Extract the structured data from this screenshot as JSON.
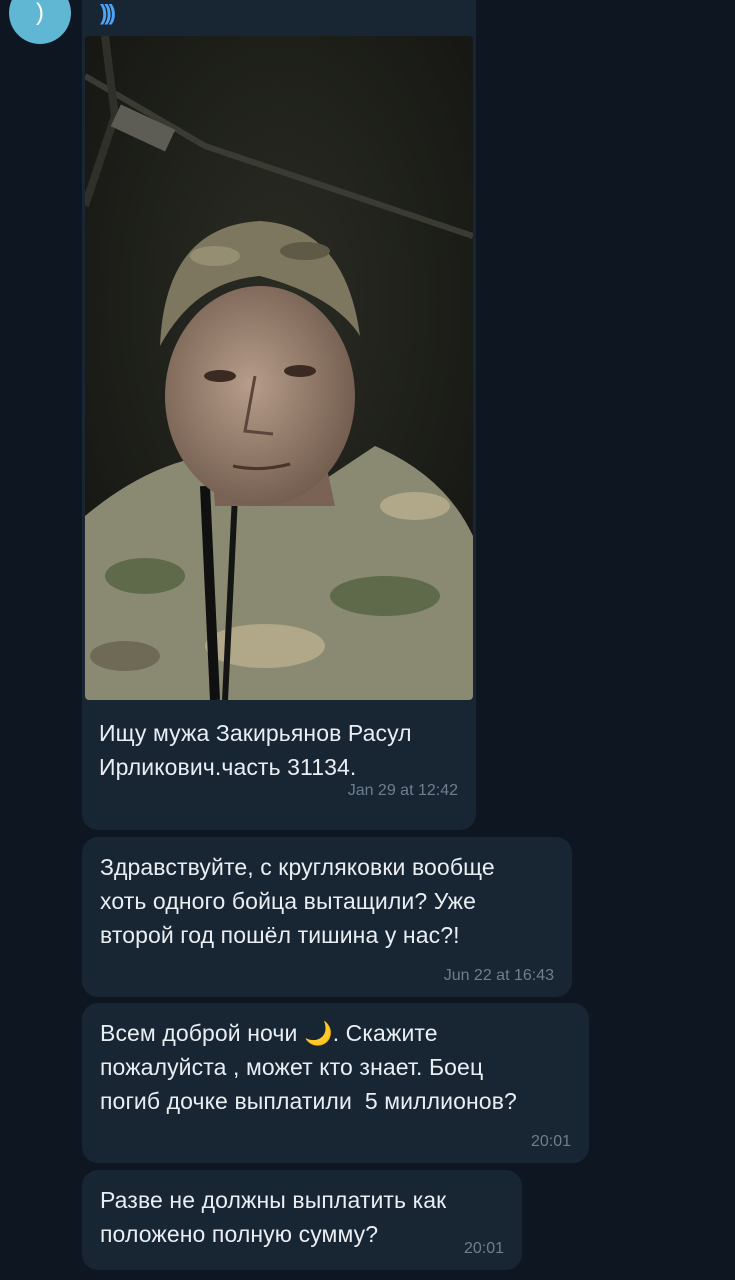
{
  "avatar": {
    "glyph": ")"
  },
  "messages": [
    {
      "caption": "Ищу мужа Закирьянов Расул\nИрликович.часть 31134.",
      "time": "Jan 29 at 12:42"
    },
    {
      "text": "Здравствуйте, с кругляковки вообще\nхоть одного бойца вытащили? Уже\nвторой год пошёл тишина у нас?!",
      "time": "Jun 22 at 16:43"
    },
    {
      "text_before_emoji": "Всем доброй ночи ",
      "emoji": "🌙",
      "text_after_emoji": ". Скажите\nпожалуйста , может кто знает. Боец\nпогиб дочке выплатили  5 миллионов?",
      "time": "20:01"
    },
    {
      "text": "Разве не должны выплатить как\nположено полную сумму?",
      "time": "20:01"
    }
  ],
  "icons": {
    "audio": "voice-wave-icon",
    "photo": "portrait-photo"
  },
  "colors": {
    "background": "#0e1621",
    "bubble": "#182533",
    "text": "#e9eef3",
    "time": "#6d7f8f",
    "avatar": "#5fb7d4",
    "accent": "#4ea4f6"
  }
}
